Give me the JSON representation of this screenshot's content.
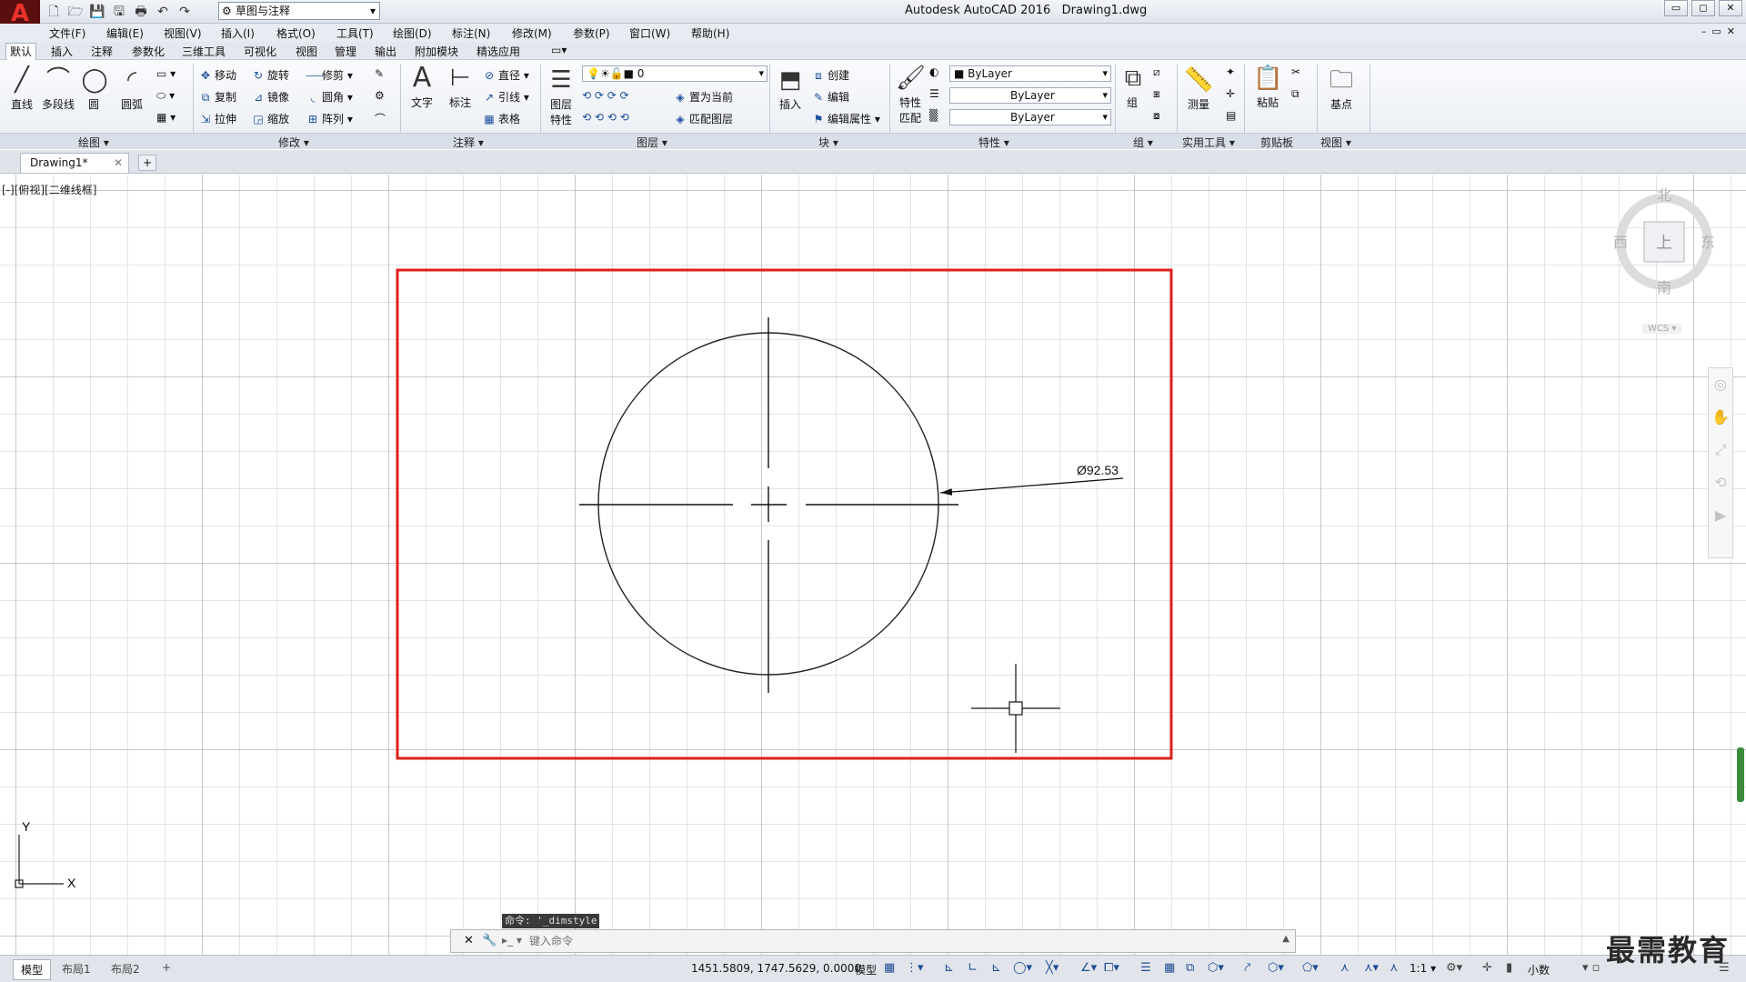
{
  "app": {
    "logo": "A",
    "title": "Autodesk AutoCAD 2016",
    "file": "Drawing1.dwg",
    "workspace": "草图与注释",
    "window_controls": [
      "▭",
      "◻",
      "✕"
    ],
    "mdi_controls": "–▭✕"
  },
  "qat": {
    "icons": [
      "new-icon",
      "open-icon",
      "save-icon",
      "saveas-icon",
      "plot-icon",
      "undo-icon",
      "redo-icon"
    ],
    "glyphs": [
      "🗋",
      "🗁",
      "💾",
      "🖫",
      "🖶",
      "↶",
      "↷"
    ]
  },
  "menu": [
    "文件(F)",
    "编辑(E)",
    "视图(V)",
    "插入(I)",
    "格式(O)",
    "工具(T)",
    "绘图(D)",
    "标注(N)",
    "修改(M)",
    "参数(P)",
    "窗口(W)",
    "帮助(H)"
  ],
  "ribbon_tabs": [
    "默认",
    "插入",
    "注释",
    "参数化",
    "三维工具",
    "可视化",
    "视图",
    "管理",
    "输出",
    "附加模块",
    "精选应用"
  ],
  "ribbon": {
    "draw": {
      "line": "直线",
      "polyline": "多段线",
      "circle": "圆",
      "arc": "圆弧",
      "panel": "绘图 ▾"
    },
    "modify": {
      "move": "移动",
      "rotate": "旋转",
      "trim": "修剪",
      "copy": "复制",
      "mirror": "镜像",
      "fillet": "圆角",
      "stretch": "拉伸",
      "scale": "缩放",
      "array": "阵列",
      "panel": "修改 ▾"
    },
    "annotation": {
      "text": "文字",
      "dimension": "标注",
      "diameter": "直径",
      "leader": "引线",
      "table": "表格",
      "panel": "注释 ▾"
    },
    "layers": {
      "layer_props": "图层特性",
      "current_layer": "0",
      "make_current": "置为当前",
      "match_layer": "匹配图层",
      "panel": "图层 ▾"
    },
    "block": {
      "insert": "插入",
      "create": "创建",
      "edit": "编辑",
      "edit_attr": "编辑属性",
      "panel": "块 ▾"
    },
    "properties": {
      "match": "特性匹配",
      "color": "ByLayer",
      "linetype": "ByLayer",
      "lineweight": "ByLayer",
      "panel": "特性 ▾"
    },
    "groups": {
      "group": "组",
      "panel": "组 ▾"
    },
    "utilities": {
      "measure": "测量",
      "panel": "实用工具 ▾"
    },
    "clipboard": {
      "paste": "粘贴",
      "panel": "剪贴板"
    },
    "view": {
      "base": "基点",
      "panel": "视图 ▾"
    }
  },
  "doc_tab": {
    "label": "Drawing1*",
    "close": "✕",
    "new": "+"
  },
  "viewport": {
    "label": "[-][俯视][二维线框]"
  },
  "navcube": {
    "north": "北",
    "south": "南",
    "east": "东",
    "west": "西",
    "top": "上",
    "wcs": "WCS ▾"
  },
  "drawing": {
    "dimension_text": "Ø92.53"
  },
  "ucs": {
    "x": "X",
    "y": "Y"
  },
  "command": {
    "history": "命令: '_dimstyle",
    "placeholder": "键入命令"
  },
  "layouts": [
    "模型",
    "布局1",
    "布局2"
  ],
  "status": {
    "coords": "1451.5809, 1747.5629, 0.0000",
    "model": "模型",
    "scale": "1:1 ▾",
    "units": "小数"
  },
  "watermark": "最需教育",
  "colors": {
    "highlight_rect": "#e0201c",
    "grid": "#c9c9c9",
    "grid_major": "#a9a9a9"
  }
}
